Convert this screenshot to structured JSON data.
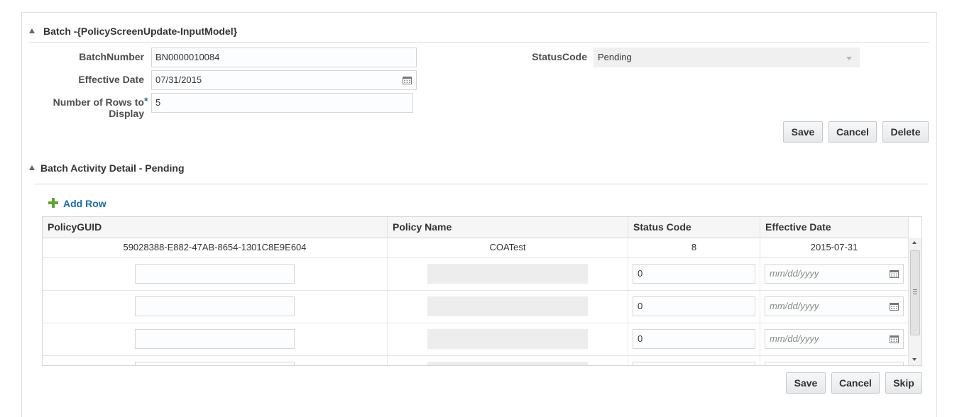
{
  "batch_section": {
    "title": "Batch -{PolicyScreenUpdate-InputModel}",
    "batch_number_label": "BatchNumber",
    "batch_number_value": "BN0000010084",
    "effective_date_label": "Effective Date",
    "effective_date_value": "07/31/2015",
    "rows_label_line1": "Number of Rows to",
    "rows_label_line2": "Display",
    "rows_required": "*",
    "rows_value": "5",
    "status_code_label": "StatusCode",
    "status_code_value": "Pending",
    "save_label": "Save",
    "cancel_label": "Cancel",
    "delete_label": "Delete"
  },
  "activity_section": {
    "title": "Batch Activity Detail - Pending",
    "add_row_label": "Add Row",
    "columns": [
      "PolicyGUID",
      "Policy Name",
      "Status Code",
      "Effective Date"
    ],
    "rows": [
      {
        "policy_guid": "59028388-E882-47AB-8654-1301C8E9E604",
        "policy_name": "COATest",
        "status_code": "8",
        "effective_date": "2015-07-31"
      }
    ],
    "new_rows": [
      {
        "status_code": "0",
        "date_placeholder": "mm/dd/yyyy"
      },
      {
        "status_code": "0",
        "date_placeholder": "mm/dd/yyyy"
      },
      {
        "status_code": "0",
        "date_placeholder": "mm/dd/yyyy"
      }
    ],
    "save_label": "Save",
    "cancel_label": "Cancel",
    "skip_label": "Skip"
  },
  "colors": {
    "link_blue": "#1d6aa5",
    "add_green": "#5ba432",
    "required_blue": "#1d6aa5"
  }
}
